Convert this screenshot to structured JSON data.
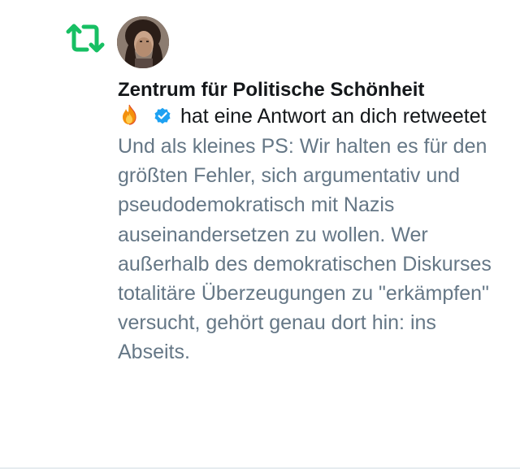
{
  "notification": {
    "account_name": "Zentrum für Politische Schönheit",
    "emoji": "🔥",
    "action_text": "hat eine Antwort an dich retweetet",
    "tweet_text": "Und als kleines PS: Wir halten es für den größten Fehler, sich argumentativ und pseudodemokratisch mit Nazis auseinandersetzen zu wollen. Wer außerhalb des demokratischen Diskurses totalitäre Überzeugungen zu \"erkämpfen\" versucht, gehört genau dort hin: ins Abseits."
  },
  "colors": {
    "retweet_green": "#17bf63",
    "verified_blue": "#1da1f2",
    "name_text": "#14171a",
    "tweet_text": "#657786"
  },
  "icons": {
    "retweet": "retweet-icon",
    "verified": "verified-badge-icon",
    "emoji": "fire-emoji"
  }
}
